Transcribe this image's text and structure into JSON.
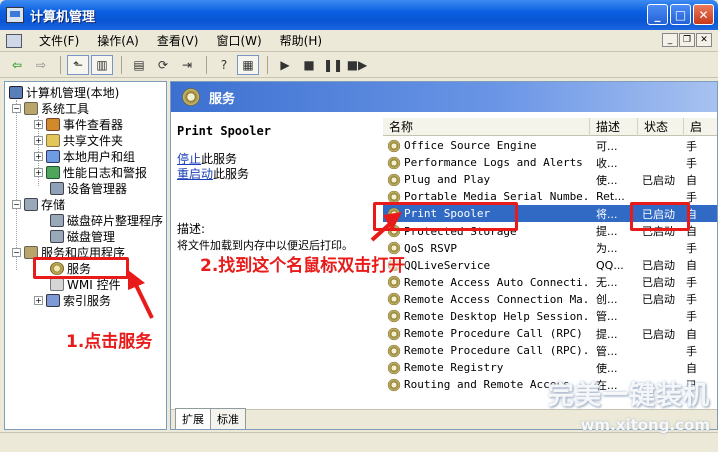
{
  "window": {
    "title": "计算机管理"
  },
  "menu": [
    "文件(F)",
    "操作(A)",
    "查看(V)",
    "窗口(W)",
    "帮助(H)"
  ],
  "tree": {
    "root": "计算机管理(本地)",
    "system_tools": "系统工具",
    "event_viewer": "事件查看器",
    "shared_folders": "共享文件夹",
    "local_users": "本地用户和组",
    "perf_logs": "性能日志和警报",
    "device_manager": "设备管理器",
    "storage": "存储",
    "defrag": "磁盘碎片整理程序",
    "disk_mgmt": "磁盘管理",
    "services_apps": "服务和应用程序",
    "services": "服务",
    "wmi": "WMI 控件",
    "indexing": "索引服务"
  },
  "pane": {
    "header": "服务",
    "detail_title": "Print Spooler",
    "stop_link": "停止",
    "stop_suffix": "此服务",
    "restart_link": "重启动",
    "restart_suffix": "此服务",
    "desc_label": "描述:",
    "desc_text": "将文件加载到内存中以便迟后打印。"
  },
  "list": {
    "headers": {
      "name": "名称",
      "desc": "描述",
      "status": "状态",
      "type": "启"
    },
    "rows": [
      {
        "name": "Office Source Engine",
        "desc": "可...",
        "status": "",
        "type": "手"
      },
      {
        "name": "Performance Logs and Alerts",
        "desc": "收...",
        "status": "",
        "type": "手"
      },
      {
        "name": "Plug and Play",
        "desc": "使...",
        "status": "已启动",
        "type": "自"
      },
      {
        "name": "Portable Media Serial Numbe...",
        "desc": "Ret...",
        "status": "",
        "type": "手"
      },
      {
        "name": "Print Spooler",
        "desc": "将...",
        "status": "已启动",
        "type": "自"
      },
      {
        "name": "Protected Storage",
        "desc": "提...",
        "status": "已启动",
        "type": "自"
      },
      {
        "name": "QoS RSVP",
        "desc": "为...",
        "status": "",
        "type": "手"
      },
      {
        "name": "QQLiveService",
        "desc": "QQ...",
        "status": "已启动",
        "type": "自"
      },
      {
        "name": "Remote Access Auto Connecti...",
        "desc": "无...",
        "status": "已启动",
        "type": "手"
      },
      {
        "name": "Remote Access Connection Ma...",
        "desc": "创...",
        "status": "已启动",
        "type": "手"
      },
      {
        "name": "Remote Desktop Help Session...",
        "desc": "管...",
        "status": "",
        "type": "手"
      },
      {
        "name": "Remote Procedure Call (RPC)",
        "desc": "提...",
        "status": "已启动",
        "type": "自"
      },
      {
        "name": "Remote Procedure Call (RPC)...",
        "desc": "管...",
        "status": "",
        "type": "手"
      },
      {
        "name": "Remote Registry",
        "desc": "使...",
        "status": "",
        "type": "自"
      },
      {
        "name": "Routing and Remote Access",
        "desc": "在...",
        "status": "",
        "type": "已"
      }
    ]
  },
  "tabs": [
    "扩展",
    "标准"
  ],
  "annotations": {
    "step1": "1.点击服务",
    "step2": "2.找到这个名鼠标双击打开",
    "highlight_color": "#e81a1a"
  },
  "watermark": {
    "brand": "完美一键装机",
    "url": "wm.xitong.com"
  }
}
